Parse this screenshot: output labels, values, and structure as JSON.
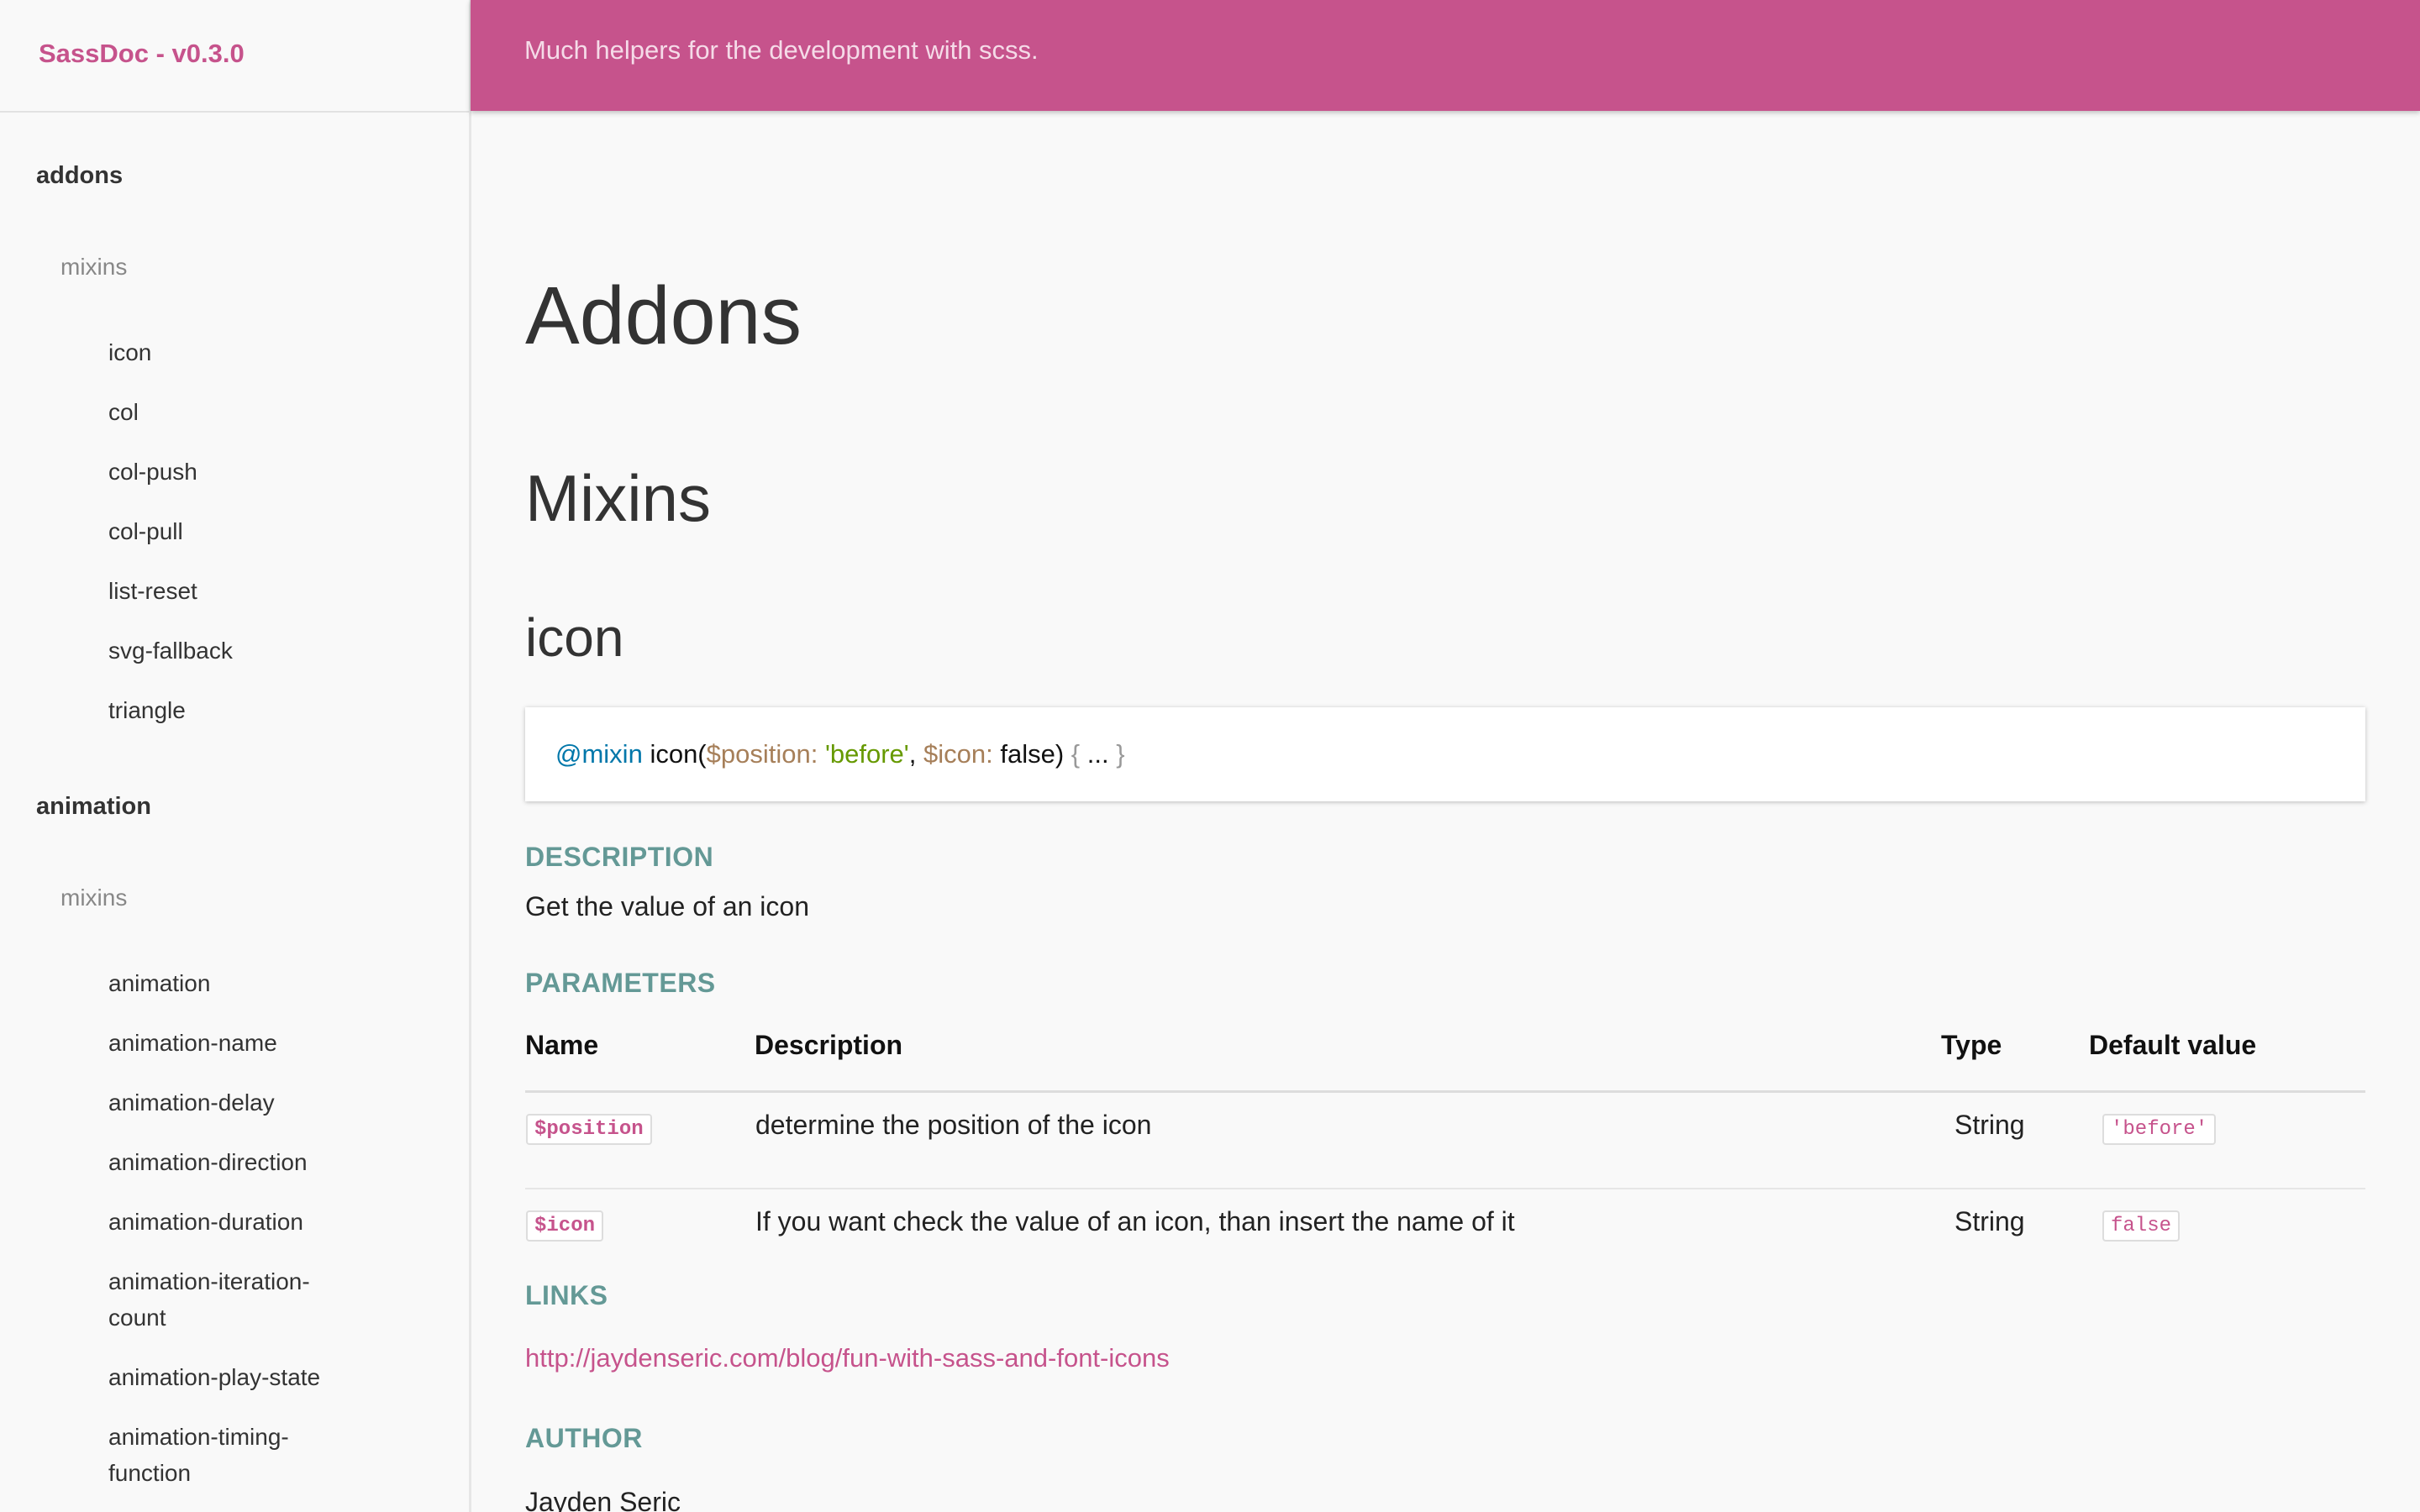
{
  "brand": {
    "title": "SassDoc - v0.3.0"
  },
  "header": {
    "tagline": "Much helpers for the development with scss.",
    "search_placeholder": ""
  },
  "sidebar": {
    "groups": [
      {
        "title": "addons",
        "sub": "mixins",
        "items": [
          "icon",
          "col",
          "col-push",
          "col-pull",
          "list-reset",
          "svg-fallback",
          "triangle"
        ]
      },
      {
        "title": "animation",
        "sub": "mixins",
        "items": [
          "animation",
          "animation-name",
          "animation-delay",
          "animation-direction",
          "animation-duration",
          "animation-iteration-count",
          "animation-play-state",
          "animation-timing-function"
        ]
      }
    ]
  },
  "main": {
    "title": "Addons",
    "section": "Mixins",
    "item_name": "icon",
    "code": {
      "keyword": "@mixin",
      "fn": "icon(",
      "param1": "$position:",
      "val1": "'before'",
      "comma": ",",
      "param2": "$icon:",
      "val2": "false)",
      "body_open": "{",
      "body_dots": "...",
      "body_close": "}"
    },
    "description_label": "DESCRIPTION",
    "description_text": "Get the value of an icon",
    "parameters_label": "PARAMETERS",
    "params_headers": {
      "name": "Name",
      "description": "Description",
      "type": "Type",
      "default": "Default value"
    },
    "params": [
      {
        "name": "$position",
        "description": "determine the position of the icon",
        "type": "String",
        "default": "'before'"
      },
      {
        "name": "$icon",
        "description": "If you want check the value of an icon, than insert the name of it",
        "type": "String",
        "default": "false"
      }
    ],
    "links_label": "LINKS",
    "link_url": "http://jaydenseric.com/blog/fun-with-sass-and-font-icons",
    "author_label": "AUTHOR",
    "author_name": "Jayden Seric"
  },
  "colors": {
    "brand": "#c6538c",
    "section_label": "#649996",
    "background": "#f9f9f9"
  }
}
